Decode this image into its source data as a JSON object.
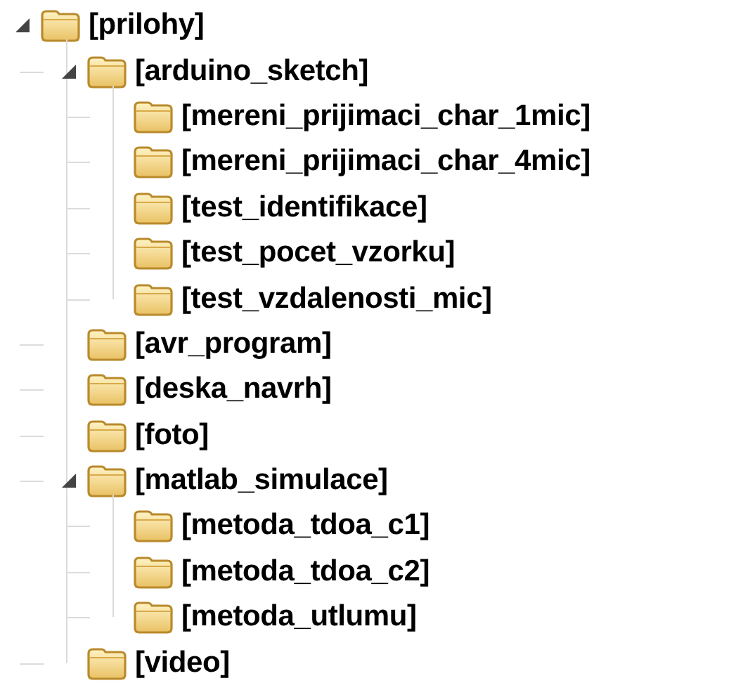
{
  "tree": [
    {
      "label": "[prilohy]",
      "expanded": true,
      "children": [
        {
          "label": "[arduino_sketch]",
          "expanded": true,
          "children": [
            {
              "label": "[mereni_prijimaci_char_1mic]"
            },
            {
              "label": "[mereni_prijimaci_char_4mic]"
            },
            {
              "label": "[test_identifikace]"
            },
            {
              "label": "[test_pocet_vzorku]"
            },
            {
              "label": "[test_vzdalenosti_mic]"
            }
          ]
        },
        {
          "label": "[avr_program]"
        },
        {
          "label": "[deska_navrh]"
        },
        {
          "label": "[foto]"
        },
        {
          "label": "[matlab_simulace]",
          "expanded": true,
          "children": [
            {
              "label": "[metoda_tdoa_c1]"
            },
            {
              "label": "[metoda_tdoa_c2]"
            },
            {
              "label": "[metoda_utlumu]"
            }
          ]
        },
        {
          "label": "[video]"
        }
      ]
    }
  ]
}
